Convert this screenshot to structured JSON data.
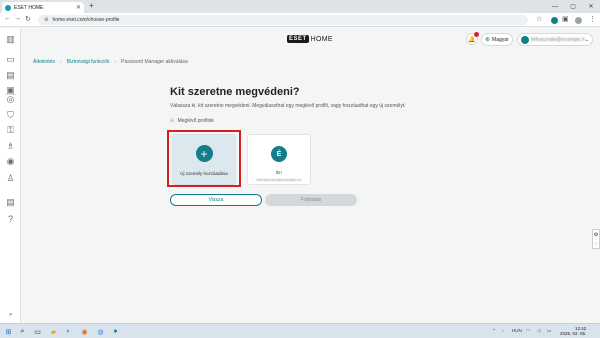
{
  "browser": {
    "tab_title": "ESET HOME",
    "tab_close": "✕",
    "new_tab": "+",
    "url": "home.eset.com/choose-profile",
    "window_controls": [
      "—",
      "▢",
      "✕"
    ]
  },
  "header": {
    "logo_mark": "ESET",
    "logo_text": "HOME",
    "language": "Magyar",
    "account_email": "felhasznalo@example.hu"
  },
  "breadcrumb": [
    "Áttekintés",
    "Biztonsági funkciók",
    "Password Manager aktiválása"
  ],
  "main": {
    "heading": "Kit szeretne megvédeni?",
    "subtitle": "Válassza ki, kit szeretne megvédeni. Megválaszthat egy meglévő profilt, vagy hozzáadhat egy új személyt.",
    "section_label": "Meglévő profilok",
    "cards": {
      "add": {
        "label": "Új személy hozzáadása",
        "icon": "+"
      },
      "me": {
        "name": "Én",
        "email": "felhasznalo@example.hu",
        "initial": "É"
      }
    },
    "buttons": {
      "back": "Vissza",
      "next": "Folytatás"
    }
  },
  "taskbar": {
    "language": "HUN",
    "time": "12:42",
    "date": "2025. 02. 05."
  },
  "colors": {
    "accent": "#127e8a",
    "highlight": "#d62020"
  }
}
